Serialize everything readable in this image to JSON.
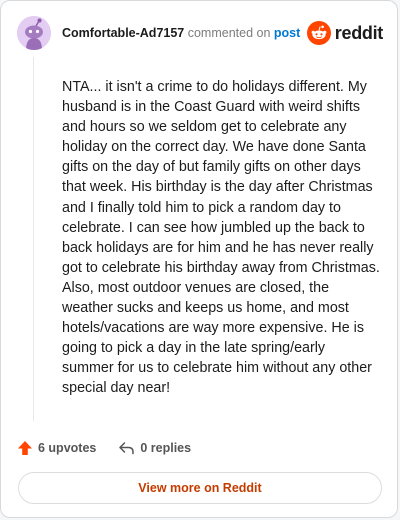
{
  "comment": {
    "author": "Comfortable-Ad7157",
    "action_text": "commented on",
    "post_link": "post",
    "body": "NTA... it isn't a crime to do holidays different. My husband is in the Coast Guard with weird shifts and hours so we seldom get to celebrate any holiday on the correct day. We have done Santa gifts on the day of but family gifts on other days that week. His birthday is the day after Christmas and I finally told him to pick a random day to celebrate. I can see how jumbled up the back to back holidays are for him and he has never really got to celebrate his birthday away from Christmas. Also, most outdoor venues are closed, the weather sucks and keeps us home, and most hotels/vacations are way more expensive. He is going to pick a day in the late spring/early summer for us to celebrate him without any other special day near!"
  },
  "brand": {
    "wordmark": "reddit",
    "color": "#ff4500"
  },
  "actions": {
    "upvotes": "6 upvotes",
    "replies": "0 replies",
    "upvote_icon": "upvote-arrow-icon",
    "reply_icon": "reply-arrow-icon"
  },
  "footer": {
    "view_more": "View more on Reddit"
  },
  "colors": {
    "accent": "#ff4500",
    "link": "#0079d3",
    "cta": "#c43c00",
    "avatar_bg": "#e6d2f5"
  }
}
